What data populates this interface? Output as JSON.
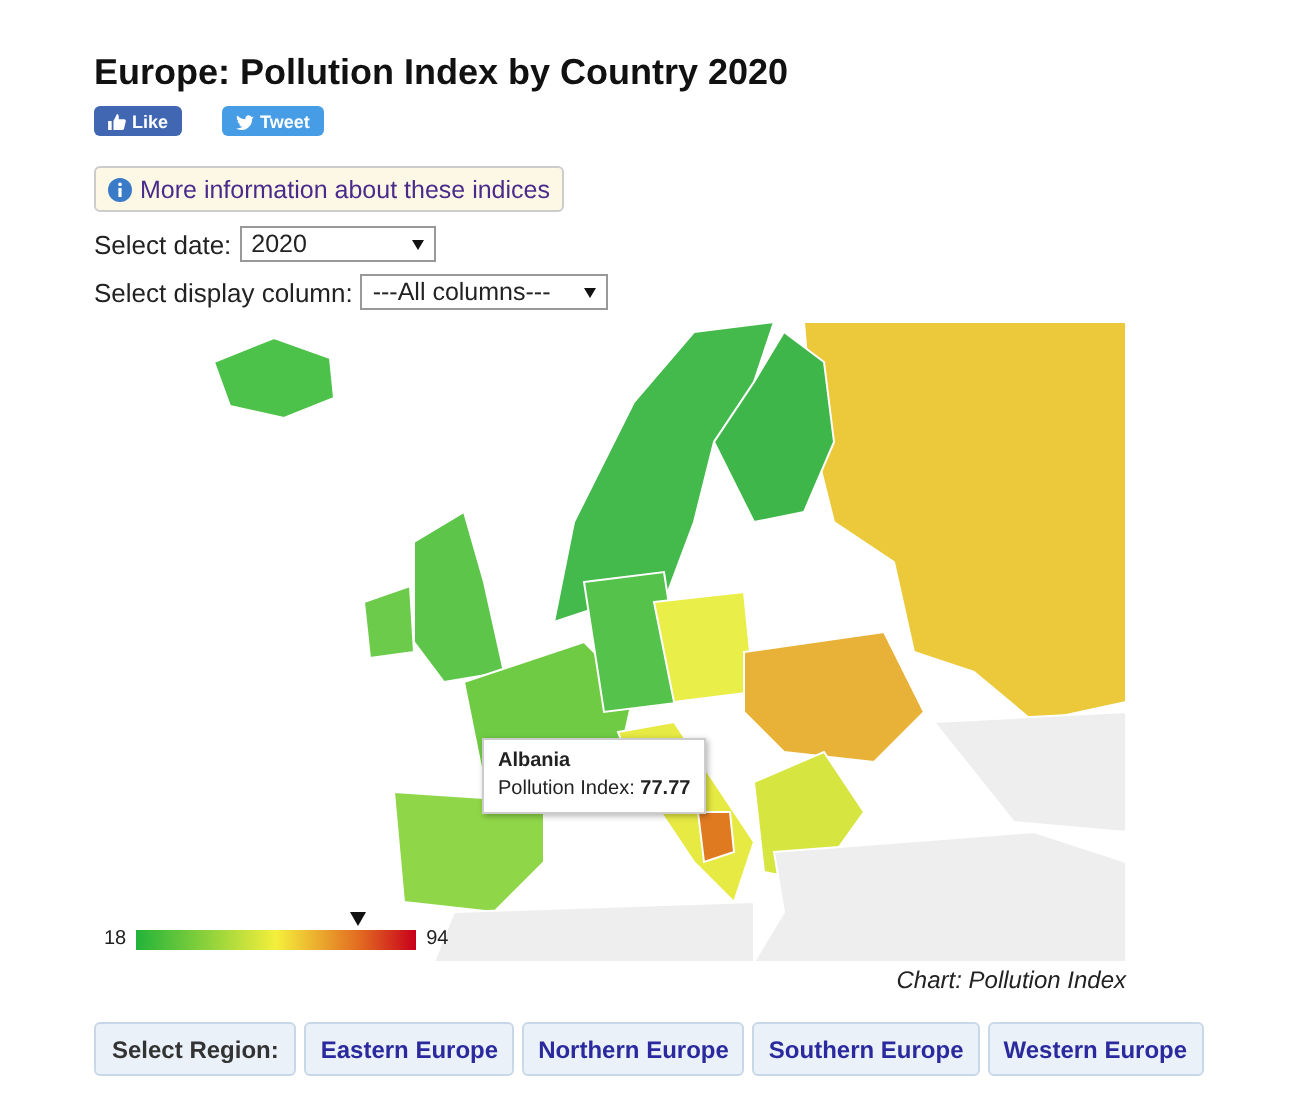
{
  "title": "Europe: Pollution Index by Country 2020",
  "social": [
    {
      "kind": "like",
      "label": "Like"
    },
    {
      "kind": "tweet",
      "label": "Tweet"
    }
  ],
  "info_button": {
    "label": "More information about these indices"
  },
  "filters": [
    {
      "label": "Select date:",
      "value": "2020"
    },
    {
      "label": "Select display column:",
      "value": "---All columns---"
    }
  ],
  "map": {
    "tooltip": {
      "title": "Albania",
      "text": "Pollution Index: **77.77**"
    },
    "legend": {
      "min": "18",
      "max": "94",
      "level": 0.79
    },
    "caption": "Chart: Pollution Index"
  },
  "regions": {
    "label": "Select Region:",
    "buttons": [
      "Eastern Europe",
      "Northern Europe",
      "Southern Europe",
      "Western Europe"
    ]
  }
}
